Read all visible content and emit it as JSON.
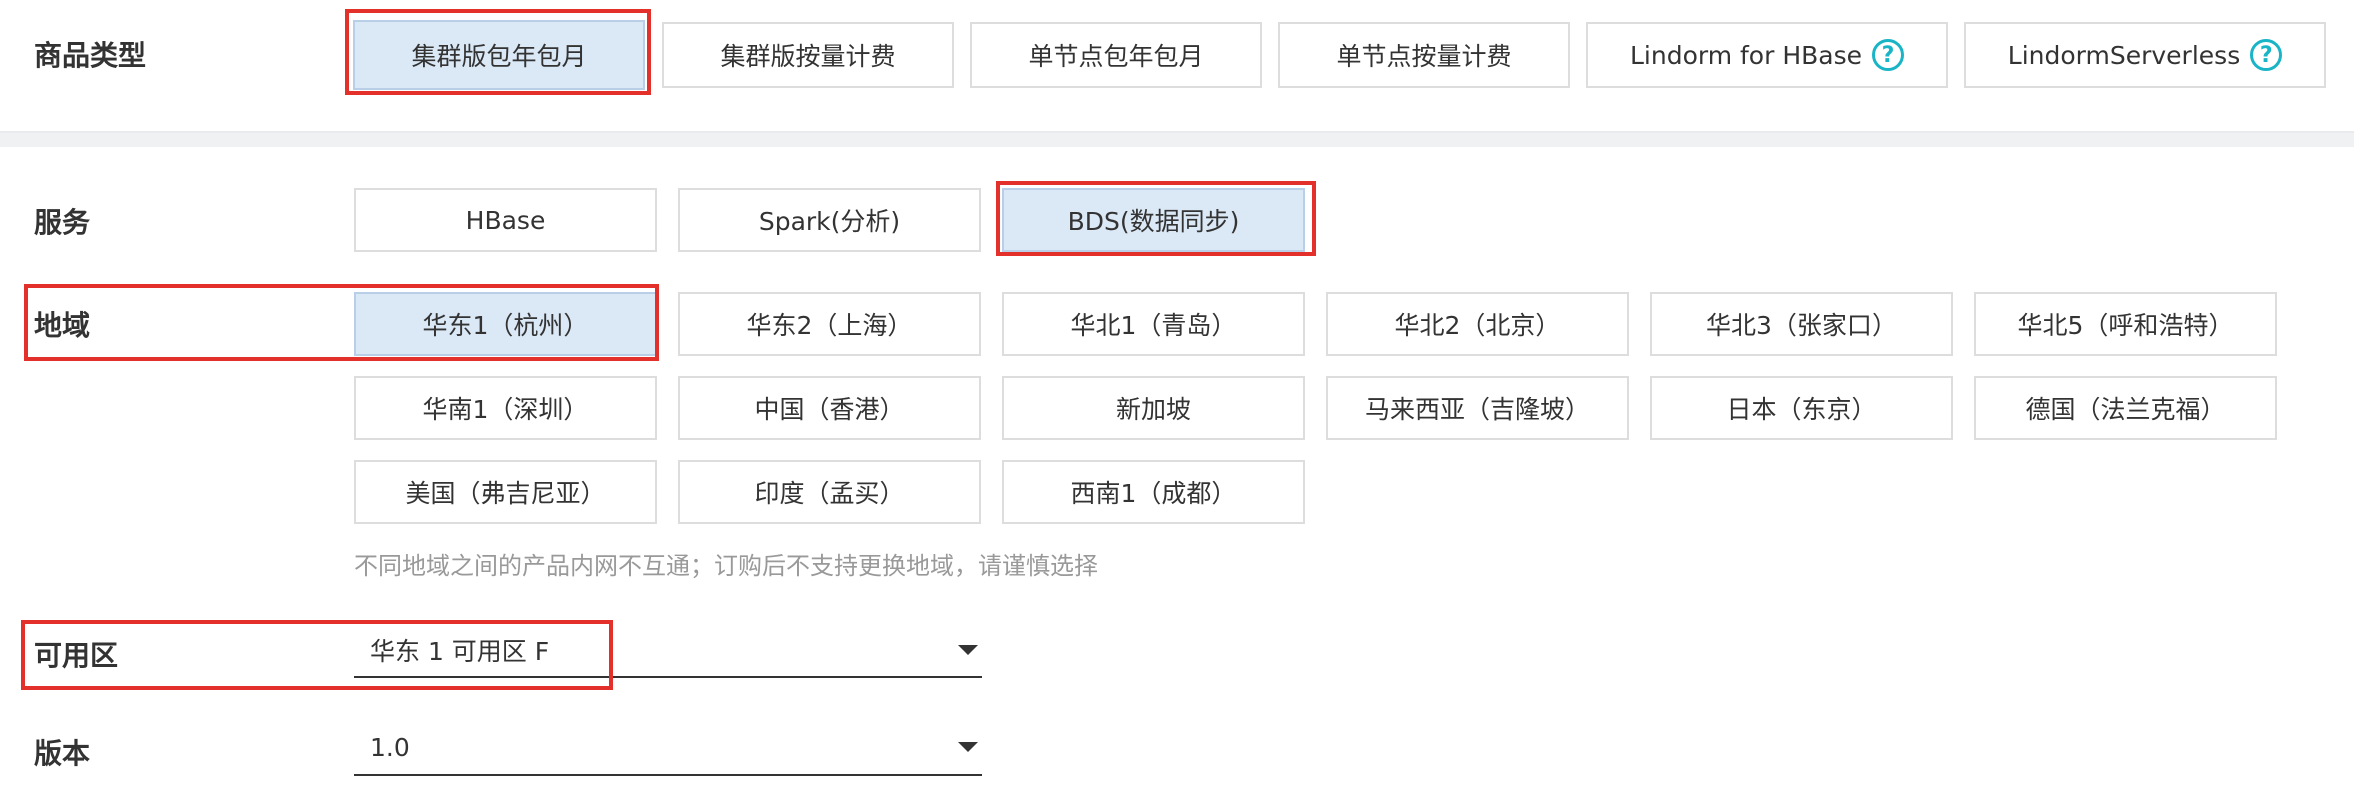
{
  "product_type": {
    "label": "商品类型",
    "options": [
      {
        "label": "集群版包年包月",
        "selected": true
      },
      {
        "label": "集群版按量计费",
        "selected": false
      },
      {
        "label": "单节点包年包月",
        "selected": false
      },
      {
        "label": "单节点按量计费",
        "selected": false
      },
      {
        "label": "Lindorm for HBase",
        "selected": false,
        "help": "?"
      },
      {
        "label": "LindormServerless",
        "selected": false,
        "help": "?"
      }
    ]
  },
  "service": {
    "label": "服务",
    "options": [
      {
        "label": "HBase",
        "selected": false
      },
      {
        "label": "Spark(分析)",
        "selected": false
      },
      {
        "label": "BDS(数据同步)",
        "selected": true
      }
    ]
  },
  "region": {
    "label": "地域",
    "options": [
      {
        "label": "华东1（杭州）",
        "selected": true
      },
      {
        "label": "华东2（上海）",
        "selected": false
      },
      {
        "label": "华北1（青岛）",
        "selected": false
      },
      {
        "label": "华北2（北京）",
        "selected": false
      },
      {
        "label": "华北3（张家口）",
        "selected": false
      },
      {
        "label": "华北5（呼和浩特）",
        "selected": false
      },
      {
        "label": "华南1（深圳）",
        "selected": false
      },
      {
        "label": "中国（香港）",
        "selected": false
      },
      {
        "label": "新加坡",
        "selected": false
      },
      {
        "label": "马来西亚（吉隆坡）",
        "selected": false
      },
      {
        "label": "日本（东京）",
        "selected": false
      },
      {
        "label": "德国（法兰克福）",
        "selected": false
      },
      {
        "label": "美国（弗吉尼亚）",
        "selected": false
      },
      {
        "label": "印度（孟买）",
        "selected": false
      },
      {
        "label": "西南1（成都）",
        "selected": false
      }
    ],
    "hint": "不同地域之间的产品内网不互通；订购后不支持更换地域，请谨慎选择"
  },
  "zone": {
    "label": "可用区",
    "value": "华东 1 可用区 F"
  },
  "version": {
    "label": "版本",
    "value": "1.0"
  },
  "colors": {
    "selected_bg": "#dbe8f6",
    "highlight_box": "#e4302b",
    "help_icon": "#1ab4c7"
  }
}
